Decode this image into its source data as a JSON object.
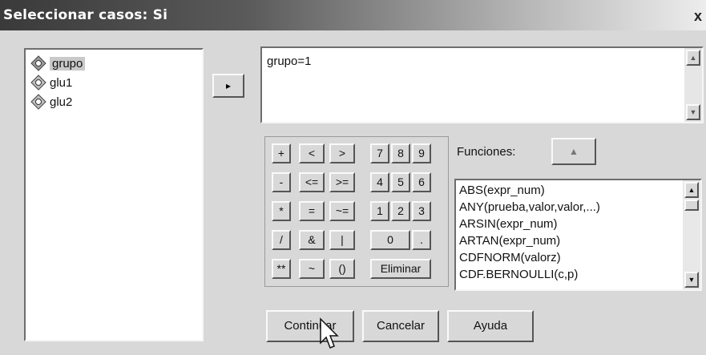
{
  "window": {
    "title": "Seleccionar casos: Si",
    "close": "x"
  },
  "variables": [
    {
      "label": "grupo",
      "selected": true,
      "icon": "scale-variable-icon"
    },
    {
      "label": "glu1",
      "selected": false,
      "icon": "scale-variable-icon"
    },
    {
      "label": "glu2",
      "selected": false,
      "icon": "scale-variable-icon"
    }
  ],
  "move_button": {
    "glyph": "▸"
  },
  "expression": {
    "value": "grupo=1"
  },
  "keypad": {
    "row1": [
      "+",
      "<",
      ">",
      "7",
      "8",
      "9"
    ],
    "row2": [
      "-",
      "<=",
      ">=",
      "4",
      "5",
      "6"
    ],
    "row3": [
      "*",
      "=",
      "~=",
      "1",
      "2",
      "3"
    ],
    "row4": [
      "/",
      "&",
      "|",
      "0",
      "."
    ],
    "row5": [
      "**",
      "~",
      "()",
      "Eliminar"
    ]
  },
  "functions": {
    "label": "Funciones:",
    "up_glyph": "▲",
    "items": [
      "ABS(expr_num)",
      "ANY(prueba,valor,valor,...)",
      "ARSIN(expr_num)",
      "ARTAN(expr_num)",
      "CDFNORM(valorz)",
      "CDF.BERNOULLI(c,p)"
    ]
  },
  "buttons": {
    "continue": "Continuar",
    "cancel": "Cancelar",
    "help": "Ayuda"
  }
}
